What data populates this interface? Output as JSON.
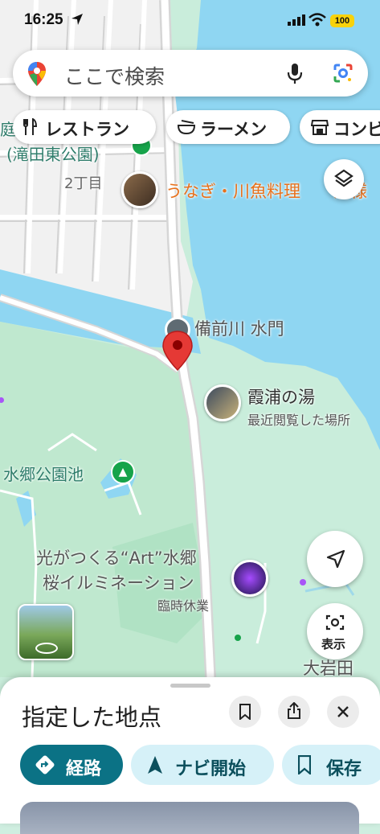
{
  "status_bar": {
    "time": "16:25",
    "battery": "100"
  },
  "search": {
    "placeholder": "ここで検索"
  },
  "chips": [
    {
      "label": "レストラン",
      "icon": "fork-knife-icon"
    },
    {
      "label": "ラーメン",
      "icon": "ramen-bowl-icon"
    },
    {
      "label": "コンビ",
      "icon": "store-icon"
    }
  ],
  "map": {
    "labels": {
      "park_top_edge": "(滝田東公園)",
      "cut_char": "庭",
      "block": "2丁目",
      "restaurant": "うなぎ・川魚料理",
      "restaurant_cut": "浦様",
      "gate": "備前川 水門",
      "onsen_name": "霞浦の湯",
      "onsen_sub": "最近閲覧した場所",
      "pond": "水郷公園池",
      "event_line1": "光がつくる“Art”水郷",
      "event_line2": "桜イルミネーション",
      "event_status": "臨時休業",
      "area": "大岩田"
    },
    "streetview_button": "street-view-thumbnail",
    "display_button_label": "表示"
  },
  "bottom_sheet": {
    "title": "指定した地点",
    "actions": [
      {
        "label": "経路",
        "icon": "directions-icon",
        "color": "#0b7285"
      },
      {
        "label": "ナビ開始",
        "icon": "navigation-arrow-icon",
        "color": "#d6f1f8"
      },
      {
        "label": "保存",
        "icon": "bookmark-icon",
        "color": "#d6f1f8"
      }
    ]
  },
  "colors": {
    "water": "#8fd6f2",
    "park": "#c6ecd6",
    "accent": "#0b7285",
    "pin": "#e53935",
    "orange_label": "#e8711c"
  }
}
